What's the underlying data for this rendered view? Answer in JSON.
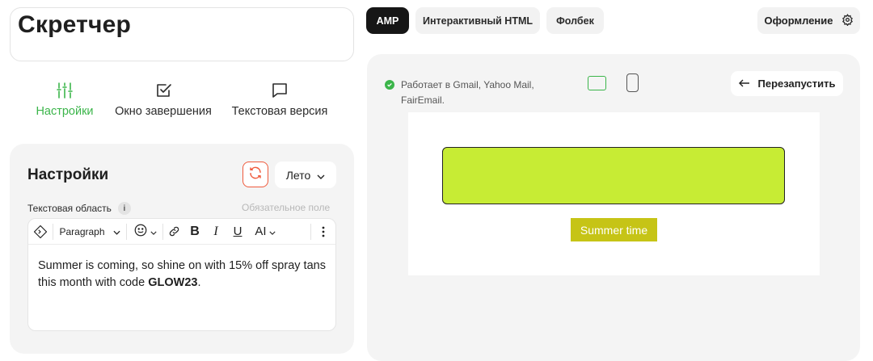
{
  "template_selector": {
    "title": "Скретчер"
  },
  "tabs": [
    {
      "label": "Настройки",
      "icon": "sliders-icon",
      "active": true
    },
    {
      "label": "Окно завершения",
      "icon": "checkbox-icon",
      "active": false
    },
    {
      "label": "Текстовая версия",
      "icon": "message-icon",
      "active": false
    }
  ],
  "settings": {
    "title": "Настройки",
    "season_select": "Лето",
    "field_label": "Текстовая область",
    "info_badge": "i",
    "required_hint": "Обязательное поле",
    "toolbar": {
      "paragraph_select": "Paragraph",
      "bold": "B",
      "italic": "I",
      "underline": "U",
      "ai": "AI"
    },
    "body_text": "Summer is coming, so shine on with 15% off spray tans this month with code ",
    "body_code": "GLOW23",
    "body_end": "."
  },
  "preview": {
    "tabs": [
      {
        "label": "AMP",
        "active": true
      },
      {
        "label": "Интерактивный HTML",
        "active": false
      },
      {
        "label": "Фолбек",
        "active": false
      }
    ],
    "design_button": "Оформление",
    "works_in": "Работает в Gmail, Yahoo Mail, FairEmail.",
    "restart_button": "Перезапустить",
    "email_button": "Summer time"
  },
  "colors": {
    "accent_green": "#3bb54a",
    "refresh_red": "#ef5a3c",
    "scratch_block": "#c7ec34",
    "email_button_bg": "#c6c416"
  }
}
